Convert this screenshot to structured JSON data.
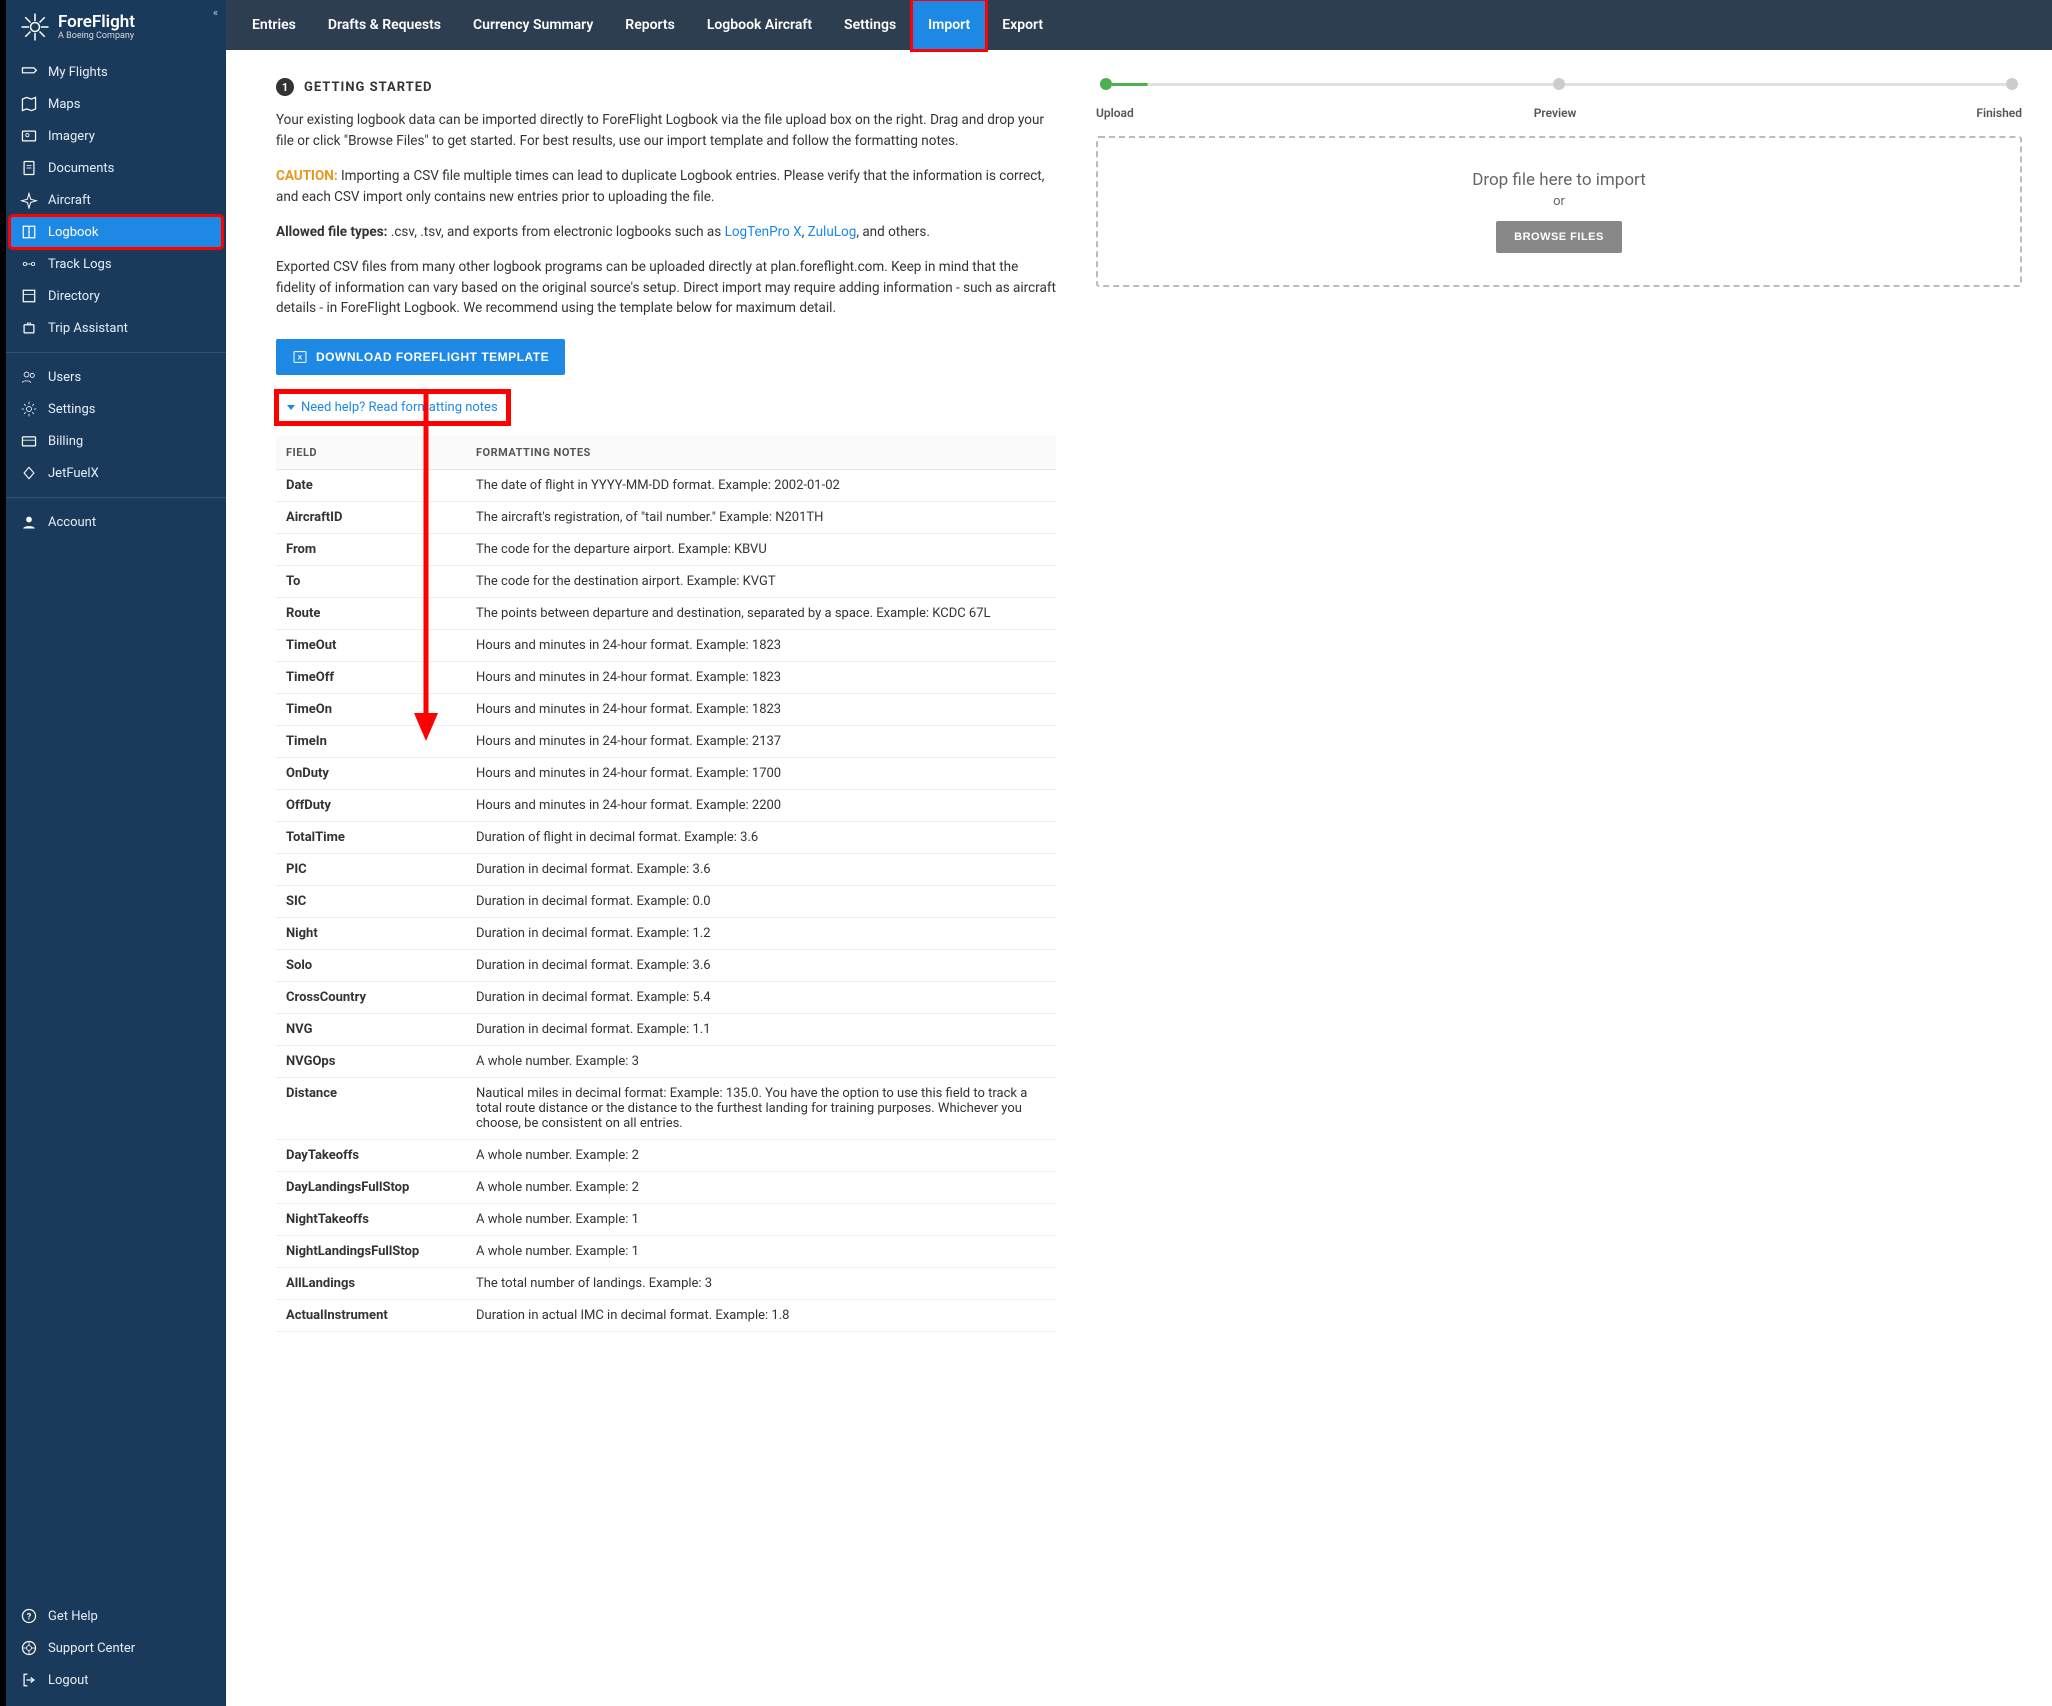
{
  "brand": {
    "name": "ForeFlight",
    "sub": "A Boeing Company"
  },
  "sidebar": {
    "groups": [
      [
        {
          "label": "My Flights",
          "icon": "flights"
        },
        {
          "label": "Maps",
          "icon": "map"
        },
        {
          "label": "Imagery",
          "icon": "imagery"
        },
        {
          "label": "Documents",
          "icon": "docs"
        },
        {
          "label": "Aircraft",
          "icon": "aircraft"
        },
        {
          "label": "Logbook",
          "icon": "logbook",
          "active": true,
          "highlight": true
        },
        {
          "label": "Track Logs",
          "icon": "tracklog"
        },
        {
          "label": "Directory",
          "icon": "directory"
        },
        {
          "label": "Trip Assistant",
          "icon": "trip"
        }
      ],
      [
        {
          "label": "Users",
          "icon": "users"
        },
        {
          "label": "Settings",
          "icon": "gear"
        },
        {
          "label": "Billing",
          "icon": "billing"
        },
        {
          "label": "JetFuelX",
          "icon": "jetfuel"
        }
      ],
      [
        {
          "label": "Account",
          "icon": "account"
        }
      ]
    ],
    "bottom": [
      {
        "label": "Get Help",
        "icon": "help"
      },
      {
        "label": "Support Center",
        "icon": "support"
      },
      {
        "label": "Logout",
        "icon": "logout"
      }
    ]
  },
  "topnav": [
    "Entries",
    "Drafts & Requests",
    "Currency Summary",
    "Reports",
    "Logbook Aircraft",
    "Settings",
    "Import",
    "Export"
  ],
  "topnav_active": "Import",
  "topnav_highlight": "Import",
  "section": {
    "step": "1",
    "title": "GETTING STARTED",
    "p1": "Your existing logbook data can be imported directly to ForeFlight Logbook via the file upload box on the right. Drag and drop your file or click \"Browse Files\" to get started. For best results, use our import template and follow the formatting notes.",
    "caution": "CAUTION:",
    "p2": " Importing a CSV file multiple times can lead to duplicate Logbook entries. Please verify that the information is correct, and each CSV import only contains new entries prior to uploading the file.",
    "allowed_label": "Allowed file types:",
    "allowed": " .csv, .tsv, and exports from electronic logbooks such as ",
    "link1": "LogTenPro X",
    "link2": "ZuluLog",
    "allowed_end": ", and others.",
    "p3": "Exported CSV files from many other logbook programs can be uploaded directly at plan.foreflight.com. Keep in mind that the fidelity of information can vary based on the original source's setup. Direct import may require adding information - such as aircraft details - in ForeFlight Logbook. We recommend using the template below for maximum detail.",
    "dl_btn": "DOWNLOAD FOREFLIGHT TEMPLATE",
    "help_link": "Need help? Read formatting notes"
  },
  "table": {
    "headers": [
      "FIELD",
      "FORMATTING NOTES"
    ],
    "rows": [
      [
        "Date",
        "The date of flight in YYYY-MM-DD format. Example: 2002-01-02"
      ],
      [
        "AircraftID",
        "The aircraft's registration, of \"tail number.\" Example: N201TH"
      ],
      [
        "From",
        "The code for the departure airport. Example: KBVU"
      ],
      [
        "To",
        "The code for the destination airport. Example: KVGT"
      ],
      [
        "Route",
        "The points between departure and destination, separated by a space. Example: KCDC 67L"
      ],
      [
        "TimeOut",
        "Hours and minutes in 24-hour format. Example: 1823"
      ],
      [
        "TimeOff",
        "Hours and minutes in 24-hour format. Example: 1823"
      ],
      [
        "TimeOn",
        "Hours and minutes in 24-hour format. Example: 1823"
      ],
      [
        "TimeIn",
        "Hours and minutes in 24-hour format. Example: 2137"
      ],
      [
        "OnDuty",
        "Hours and minutes in 24-hour format. Example: 1700"
      ],
      [
        "OffDuty",
        "Hours and minutes in 24-hour format. Example: 2200"
      ],
      [
        "TotalTime",
        "Duration of flight in decimal format. Example: 3.6"
      ],
      [
        "PIC",
        "Duration in decimal format. Example: 3.6"
      ],
      [
        "SIC",
        "Duration in decimal format. Example: 0.0"
      ],
      [
        "Night",
        "Duration in decimal format. Example: 1.2"
      ],
      [
        "Solo",
        "Duration in decimal format. Example: 3.6"
      ],
      [
        "CrossCountry",
        "Duration in decimal format. Example: 5.4"
      ],
      [
        "NVG",
        "Duration in decimal format. Example: 1.1"
      ],
      [
        "NVGOps",
        "A whole number. Example: 3"
      ],
      [
        "Distance",
        "Nautical miles in decimal format: Example: 135.0. You have the option to use this field to track a total route distance or the distance to the furthest landing for training purposes. Whichever you choose, be consistent on all entries."
      ],
      [
        "DayTakeoffs",
        "A whole number. Example: 2"
      ],
      [
        "DayLandingsFullStop",
        "A whole number. Example: 2"
      ],
      [
        "NightTakeoffs",
        "A whole number. Example: 1"
      ],
      [
        "NightLandingsFullStop",
        "A whole number. Example: 1"
      ],
      [
        "AllLandings",
        "The total number of landings. Example: 3"
      ],
      [
        "ActualInstrument",
        "Duration in actual IMC in decimal format. Example: 1.8"
      ]
    ]
  },
  "stepper": {
    "labels": [
      "Upload",
      "Preview",
      "Finished"
    ]
  },
  "dropzone": {
    "line1": "Drop file here to import",
    "or": "or",
    "btn": "BROWSE FILES"
  }
}
